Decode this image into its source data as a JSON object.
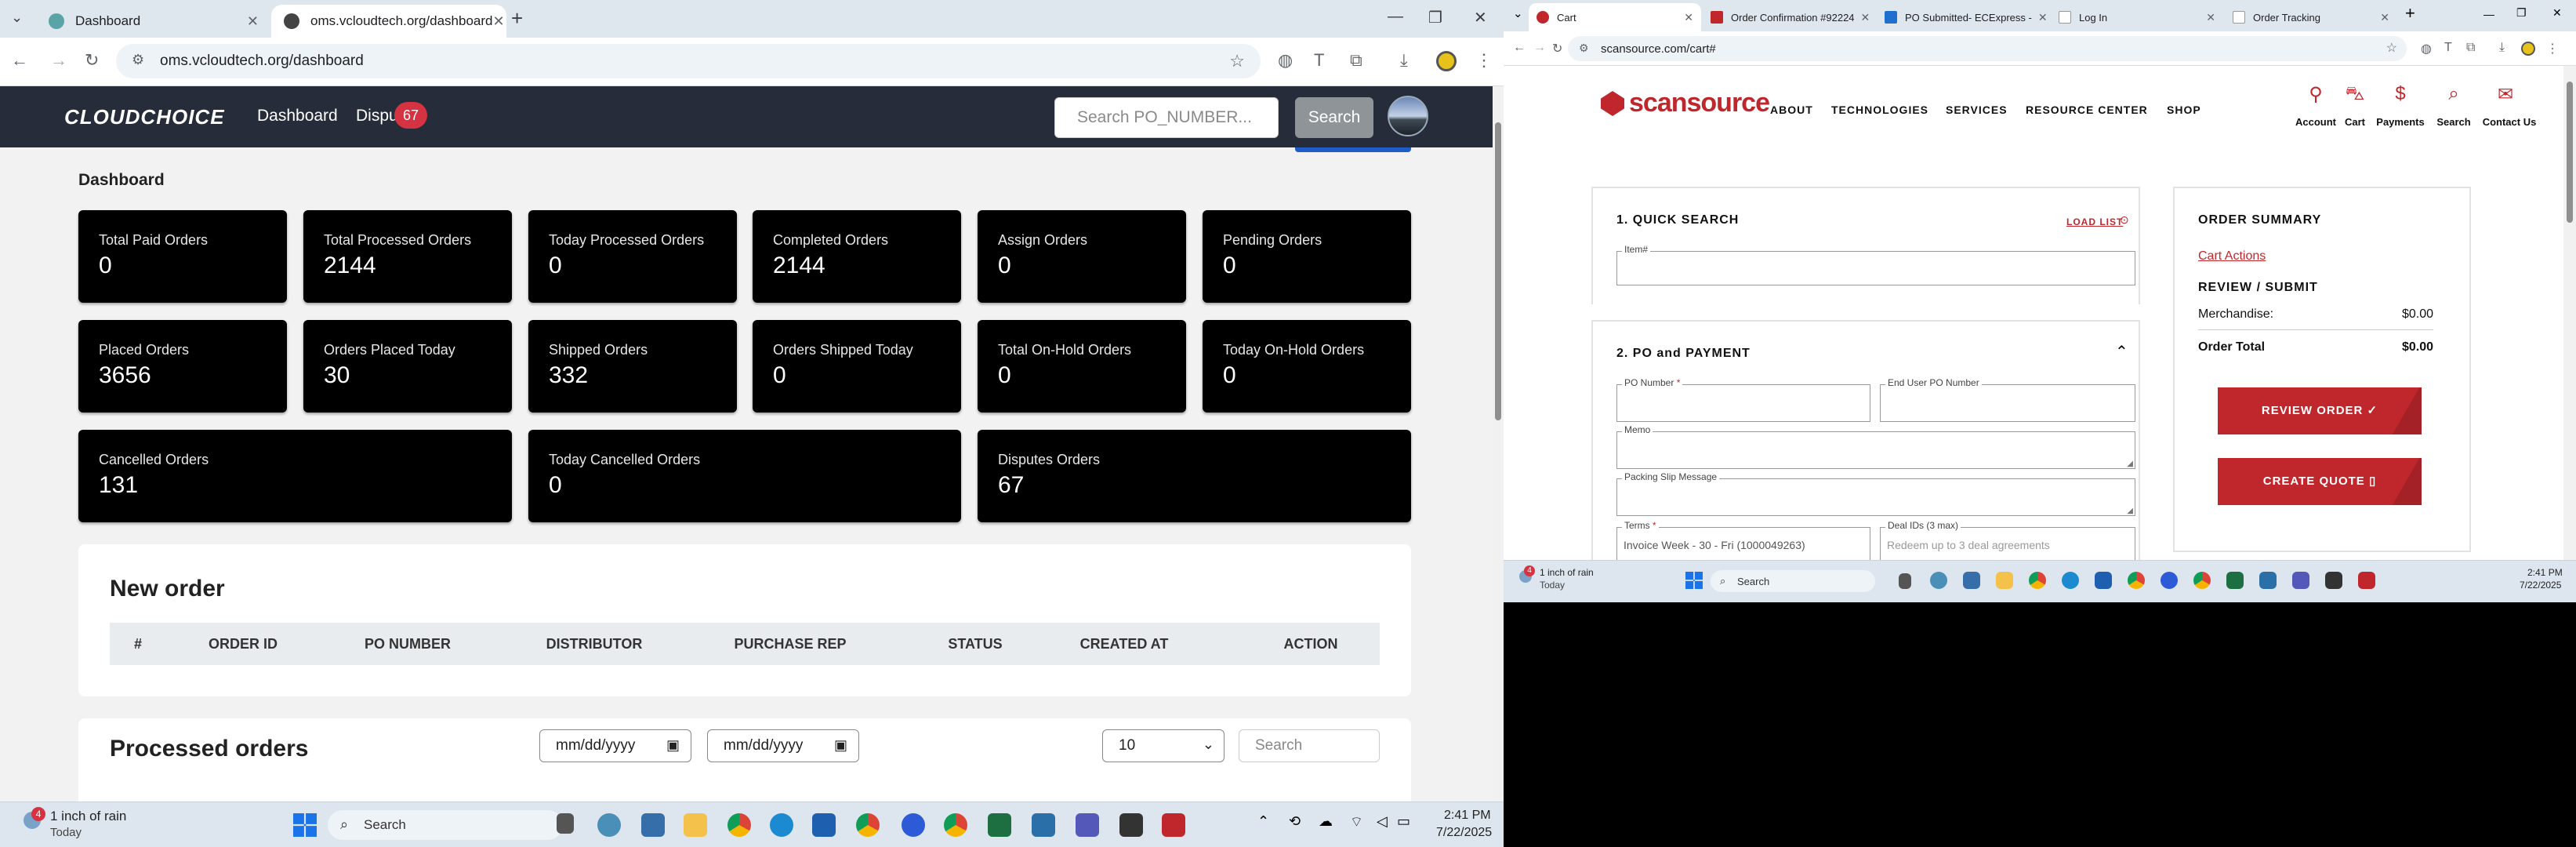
{
  "left_browser": {
    "tabs": [
      {
        "label": "Dashboard",
        "active": false
      },
      {
        "label": "oms.vcloudtech.org/dashboard",
        "active": true
      }
    ],
    "url": "oms.vcloudtech.org/dashboard",
    "navbar": {
      "brand": "CLOUDCHOICE",
      "links": [
        "Dashboard",
        "Dispu"
      ],
      "disputes_badge": "67",
      "search_placeholder": "Search PO_NUMBER...",
      "search_button": "Search"
    },
    "dashboard_title": "Dashboard",
    "cards": [
      {
        "label": "Total Paid Orders",
        "value": "0"
      },
      {
        "label": "Total Processed Orders",
        "value": "2144"
      },
      {
        "label": "Today Processed Orders",
        "value": "0"
      },
      {
        "label": "Completed Orders",
        "value": "2144"
      },
      {
        "label": "Assign Orders",
        "value": "0"
      },
      {
        "label": "Pending Orders",
        "value": "0"
      },
      {
        "label": "Placed Orders",
        "value": "3656"
      },
      {
        "label": "Orders Placed Today",
        "value": "30"
      },
      {
        "label": "Shipped Orders",
        "value": "332"
      },
      {
        "label": "Orders Shipped Today",
        "value": "0"
      },
      {
        "label": "Total On-Hold Orders",
        "value": "0"
      },
      {
        "label": "Today On-Hold Orders",
        "value": "0"
      },
      {
        "label": "Cancelled Orders",
        "value": "131"
      },
      {
        "label": "Today Cancelled Orders",
        "value": "0"
      },
      {
        "label": "Disputes Orders",
        "value": "67"
      }
    ],
    "new_order": {
      "title": "New order",
      "columns": [
        "#",
        "ORDER ID",
        "PO NUMBER",
        "DISTRIBUTOR",
        "PURCHASE REP",
        "STATUS",
        "CREATED AT",
        "ACTION"
      ]
    },
    "processed_orders": {
      "title": "Processed orders",
      "date_from": "mm/dd/yyyy",
      "date_to": "mm/dd/yyyy",
      "page_size": "10",
      "search_placeholder": "Search"
    },
    "taskbar": {
      "weather": "1 inch of rain",
      "weather_sub": "Today",
      "search": "Search",
      "time": "2:41 PM",
      "date": "7/22/2025",
      "weather_badge": "4"
    }
  },
  "right_browser": {
    "tabs": [
      {
        "label": "Cart",
        "active": true
      },
      {
        "label": "Order Confirmation #92224",
        "active": false
      },
      {
        "label": "PO Submitted- ECExpress -",
        "active": false
      },
      {
        "label": "Log In",
        "active": false
      },
      {
        "label": "Order Tracking",
        "active": false
      }
    ],
    "url": "scansource.com/cart#",
    "brand": "scansource",
    "nav": [
      "ABOUT",
      "TECHNOLOGIES",
      "SERVICES",
      "RESOURCE CENTER",
      "SHOP"
    ],
    "icons": [
      "Account",
      "Cart",
      "Payments",
      "Search",
      "Contact Us"
    ],
    "quick_search": {
      "title": "1. QUICK SEARCH",
      "load_list": "LOAD LIST",
      "item_label": "Item#"
    },
    "po_payment": {
      "title": "2. PO and PAYMENT",
      "po_number_label": "PO Number",
      "end_user_po_label": "End User PO Number",
      "memo_label": "Memo",
      "packing_slip_label": "Packing Slip Message",
      "terms_label": "Terms",
      "terms_value": "Invoice Week - 30 - Fri (1000049263)",
      "deal_ids_label": "Deal IDs (3 max)",
      "deal_ids_placeholder": "Redeem up to 3 deal agreements",
      "required_mark": "*"
    },
    "order_summary": {
      "title": "ORDER SUMMARY",
      "cart_actions": "Cart Actions",
      "review_submit": "REVIEW / SUBMIT",
      "merchandise_label": "Merchandise:",
      "merchandise_value": "$0.00",
      "total_label": "Order Total",
      "total_value": "$0.00",
      "review_button": "REVIEW ORDER ✓",
      "quote_button": "CREATE QUOTE ▯"
    },
    "taskbar": {
      "weather": "1 inch of rain",
      "weather_sub": "Today",
      "search": "Search",
      "time": "2:41 PM",
      "date": "7/22/2025",
      "weather_badge": "4"
    }
  }
}
